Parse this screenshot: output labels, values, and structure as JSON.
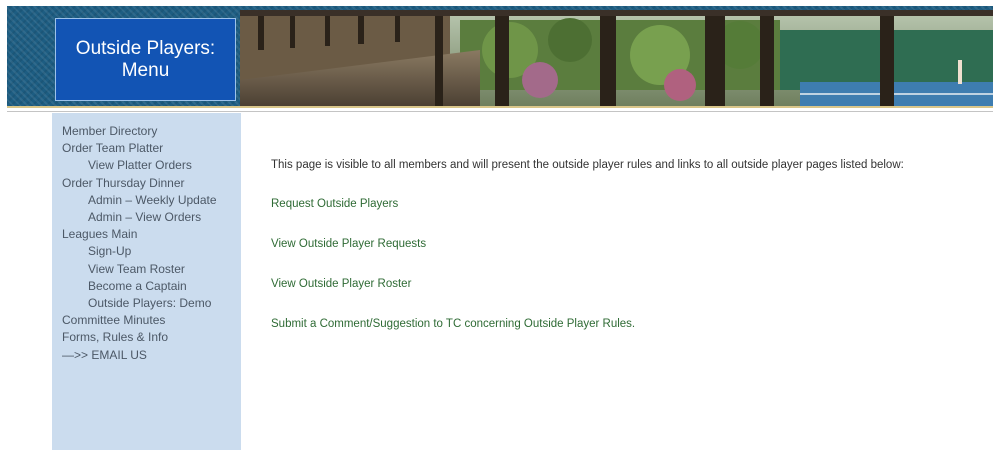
{
  "header": {
    "title_line1": "Outside Players:",
    "title_line2": "Menu",
    "banner_image": "tennis-courts-photo"
  },
  "sidebar": {
    "items": [
      {
        "label": "Member Directory",
        "level": 0
      },
      {
        "label": "Order Team Platter",
        "level": 0
      },
      {
        "label": "View Platter Orders",
        "level": 1
      },
      {
        "label": "Order Thursday Dinner",
        "level": 0
      },
      {
        "label": "Admin – Weekly Update",
        "level": 1
      },
      {
        "label": "Admin – View Orders",
        "level": 1
      },
      {
        "label": "Leagues Main",
        "level": 0
      },
      {
        "label": "Sign-Up",
        "level": 1
      },
      {
        "label": "View Team Roster",
        "level": 1
      },
      {
        "label": "Become a Captain",
        "level": 1
      },
      {
        "label": "Outside Players: Demo",
        "level": 1
      },
      {
        "label": "Committee Minutes",
        "level": 0
      },
      {
        "label": "Forms, Rules & Info",
        "level": 0
      },
      {
        "label": "—>> EMAIL US",
        "level": 0
      }
    ]
  },
  "main": {
    "intro": "This page is visible to all members and will present the outside player rules and links to all outside player pages listed below:",
    "links": [
      "Request Outside Players",
      "View Outside Player Requests",
      "View Outside Player Roster",
      "Submit a Comment/Suggestion to TC concerning Outside Player Rules."
    ]
  },
  "colors": {
    "title_box": "#1254b4",
    "sidebar_bg": "#cbdcee",
    "link": "#2f6b35",
    "nav_text": "#4c5866"
  }
}
